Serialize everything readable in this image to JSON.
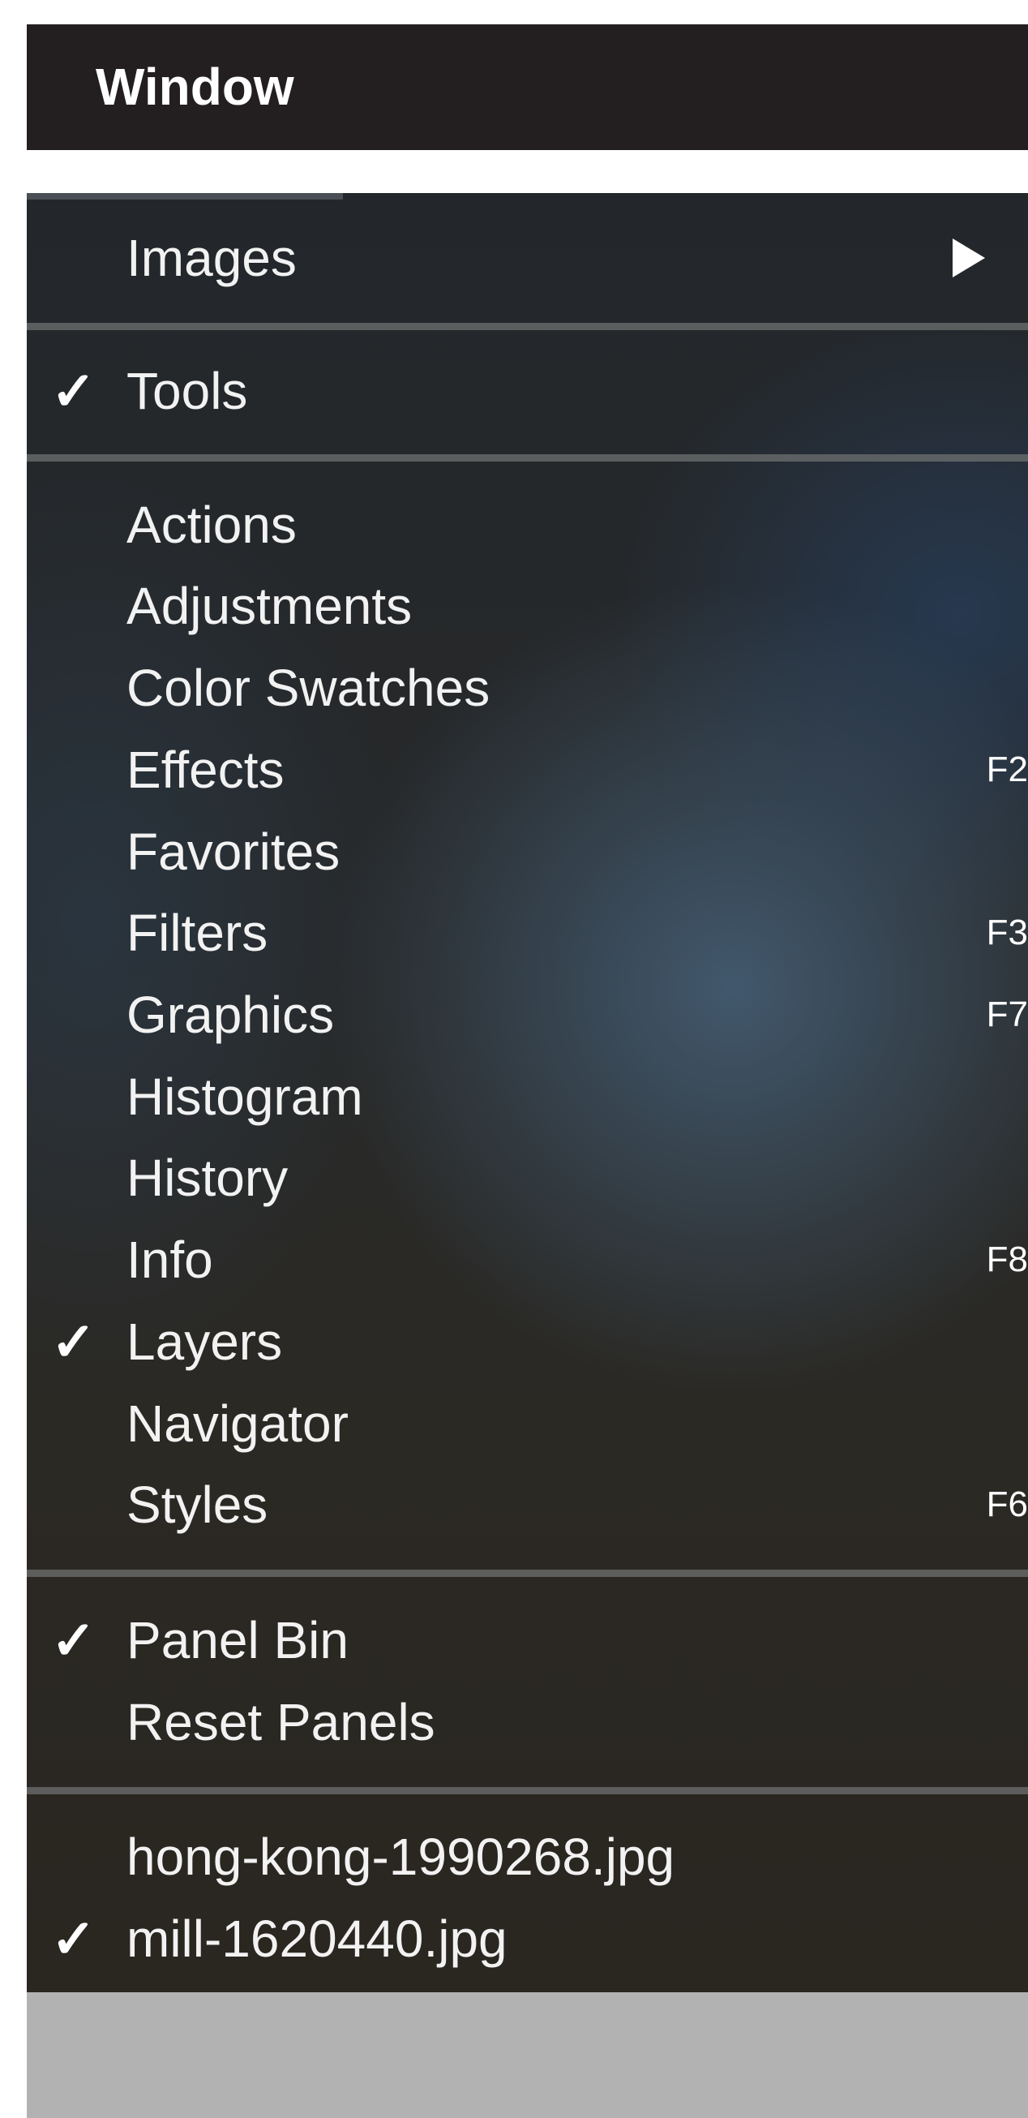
{
  "menubar": {
    "title": "Window"
  },
  "menu": {
    "groups": [
      {
        "items": [
          {
            "label": "Images",
            "checked": false,
            "submenu": true,
            "shortcut": ""
          }
        ]
      },
      {
        "items": [
          {
            "label": "Tools",
            "checked": true,
            "shortcut": ""
          }
        ]
      },
      {
        "items": [
          {
            "label": "Actions",
            "checked": false,
            "shortcut": ""
          },
          {
            "label": "Adjustments",
            "checked": false,
            "shortcut": ""
          },
          {
            "label": "Color Swatches",
            "checked": false,
            "shortcut": ""
          },
          {
            "label": "Effects",
            "checked": false,
            "shortcut": "F2"
          },
          {
            "label": "Favorites",
            "checked": false,
            "shortcut": ""
          },
          {
            "label": "Filters",
            "checked": false,
            "shortcut": "F3"
          },
          {
            "label": "Graphics",
            "checked": false,
            "shortcut": "F7"
          },
          {
            "label": "Histogram",
            "checked": false,
            "shortcut": ""
          },
          {
            "label": "History",
            "checked": false,
            "shortcut": ""
          },
          {
            "label": "Info",
            "checked": false,
            "shortcut": "F8"
          },
          {
            "label": "Layers",
            "checked": true,
            "shortcut": ""
          },
          {
            "label": "Navigator",
            "checked": false,
            "shortcut": ""
          },
          {
            "label": "Styles",
            "checked": false,
            "shortcut": "F6"
          }
        ]
      },
      {
        "items": [
          {
            "label": "Panel Bin",
            "checked": true,
            "shortcut": ""
          },
          {
            "label": "Reset Panels",
            "checked": false,
            "shortcut": ""
          }
        ]
      },
      {
        "items": [
          {
            "label": "hong-kong-1990268.jpg",
            "checked": false,
            "shortcut": ""
          },
          {
            "label": "mill-1620440.jpg",
            "checked": true,
            "shortcut": ""
          }
        ]
      }
    ],
    "check_glyph": "✓",
    "submenu_icon": "triangle-right-icon",
    "colors": {
      "menubar_bg": "#231f20",
      "text": "#f2f2f2",
      "bottom_area": "#b2b2b2"
    }
  }
}
